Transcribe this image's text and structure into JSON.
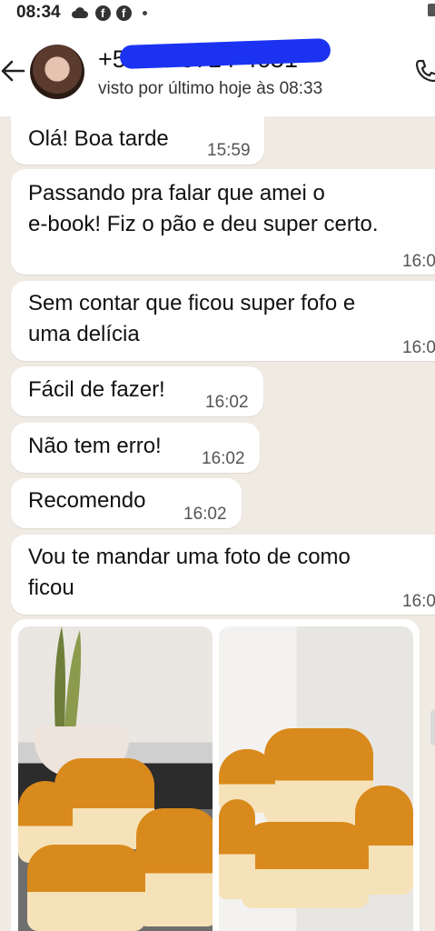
{
  "status_bar": {
    "time": "08:34"
  },
  "header": {
    "contact_name": "+55 16 0714-4651",
    "last_seen": "visto por último hoje às 08:33"
  },
  "messages": [
    {
      "text": "Olá! Boa tarde",
      "time": "15:59"
    },
    {
      "text": "Passando pra falar que amei o",
      "text2": "e-book! Fiz o pão e deu super certo.",
      "time": "16:0"
    },
    {
      "text": "Sem contar que ficou super fofo e",
      "text2": "uma delícia",
      "time": "16:0"
    },
    {
      "text": "Fácil de fazer!",
      "time": "16:02"
    },
    {
      "text": "Não tem erro!",
      "time": "16:02"
    },
    {
      "text": "Recomendo",
      "time": "16:02"
    },
    {
      "text": "Vou te mandar uma foto de como",
      "text2": "ficou",
      "time": "16:0"
    }
  ],
  "colors": {
    "chat_background": "#efeae2",
    "bubble": "#ffffff",
    "redaction": "#1b33f0"
  }
}
